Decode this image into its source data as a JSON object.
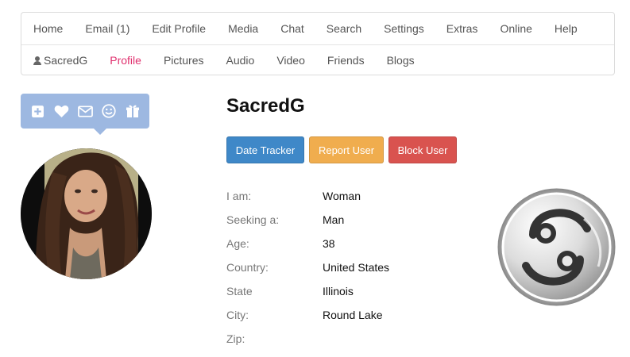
{
  "nav": {
    "primary": [
      {
        "label": "Home",
        "name": "nav-home"
      },
      {
        "label": "Email (1)",
        "name": "nav-email"
      },
      {
        "label": "Edit Profile",
        "name": "nav-edit-profile"
      },
      {
        "label": "Media",
        "name": "nav-media"
      },
      {
        "label": "Chat",
        "name": "nav-chat"
      },
      {
        "label": "Search",
        "name": "nav-search"
      },
      {
        "label": "Settings",
        "name": "nav-settings"
      },
      {
        "label": "Extras",
        "name": "nav-extras"
      },
      {
        "label": "Online",
        "name": "nav-online"
      },
      {
        "label": "Help",
        "name": "nav-help"
      }
    ],
    "secondary": [
      {
        "label": "SacredG",
        "name": "subnav-username"
      },
      {
        "label": "Profile",
        "name": "subnav-profile"
      },
      {
        "label": "Pictures",
        "name": "subnav-pictures"
      },
      {
        "label": "Audio",
        "name": "subnav-audio"
      },
      {
        "label": "Video",
        "name": "subnav-video"
      },
      {
        "label": "Friends",
        "name": "subnav-friends"
      },
      {
        "label": "Blogs",
        "name": "subnav-blogs"
      }
    ],
    "active_secondary": "Profile",
    "active_color": "#e0306e"
  },
  "action_icons": [
    "plus-square-icon",
    "heart-icon",
    "envelope-icon",
    "smile-icon",
    "gift-icon"
  ],
  "profile": {
    "username": "SacredG",
    "buttons": {
      "date_tracker": "Date Tracker",
      "report_user": "Report User",
      "block_user": "Block User"
    },
    "button_colors": {
      "date_tracker": "#3f88c8",
      "report_user": "#f0ad4e",
      "block_user": "#d9534f"
    },
    "details": [
      {
        "label": "I am:",
        "value": "Woman"
      },
      {
        "label": "Seeking a:",
        "value": "Man"
      },
      {
        "label": "Age:",
        "value": "38"
      },
      {
        "label": "Country:",
        "value": "United States"
      },
      {
        "label": "State",
        "value": "Illinois"
      },
      {
        "label": "City:",
        "value": "Round Lake"
      },
      {
        "label": "Zip:",
        "value": ""
      }
    ],
    "zodiac_icon": "cancer-zodiac-icon"
  }
}
